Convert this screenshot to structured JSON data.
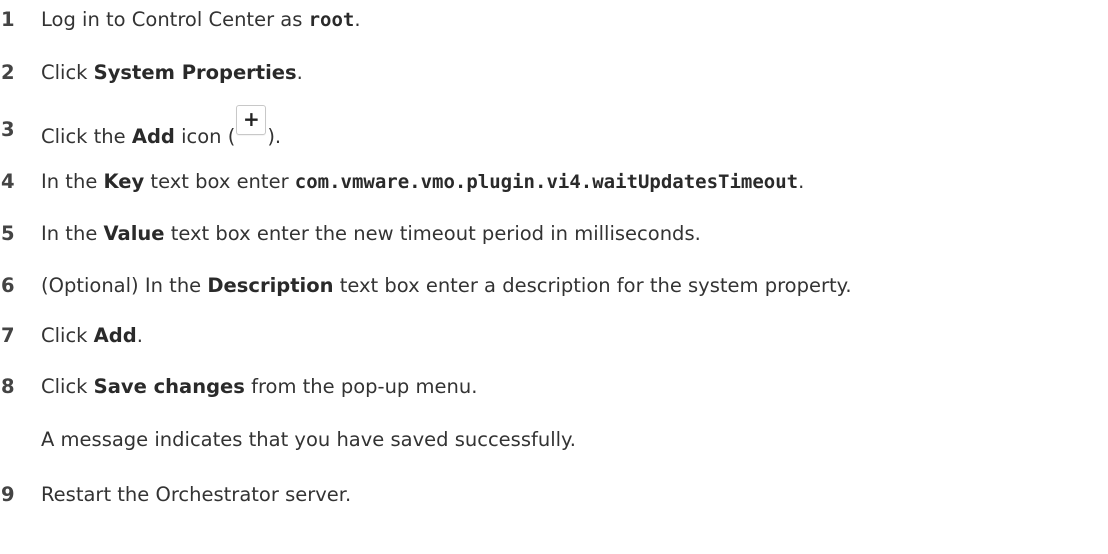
{
  "steps": [
    {
      "num": "1",
      "pre": "Log in to Control Center as ",
      "code": "root",
      "post": "."
    },
    {
      "num": "2",
      "pre": "Click ",
      "bold": "System Properties",
      "post": "."
    },
    {
      "num": "3",
      "pre": "Click the ",
      "bold": "Add",
      "mid": " icon (",
      "icon": "+",
      "post": ")."
    },
    {
      "num": "4",
      "pre": "In the ",
      "bold": "Key",
      "mid": " text box enter ",
      "code": "com.vmware.vmo.plugin.vi4.waitUpdatesTimeout",
      "post": "."
    },
    {
      "num": "5",
      "pre": "In the ",
      "bold": "Value",
      "post": " text box enter the new timeout period in milliseconds."
    },
    {
      "num": "6",
      "pre": "(Optional) In the ",
      "bold": "Description",
      "post": " text box enter a description for the system property."
    },
    {
      "num": "7",
      "pre": "Click ",
      "bold": "Add",
      "post": "."
    },
    {
      "num": "8",
      "pre": "Click ",
      "bold": "Save changes",
      "post": " from the pop-up menu."
    },
    {
      "num": "9",
      "pre": "Restart the Orchestrator server."
    }
  ],
  "step8_result": "A message indicates that you have saved successfully.",
  "icons": {
    "add_icon": "plus-icon"
  }
}
